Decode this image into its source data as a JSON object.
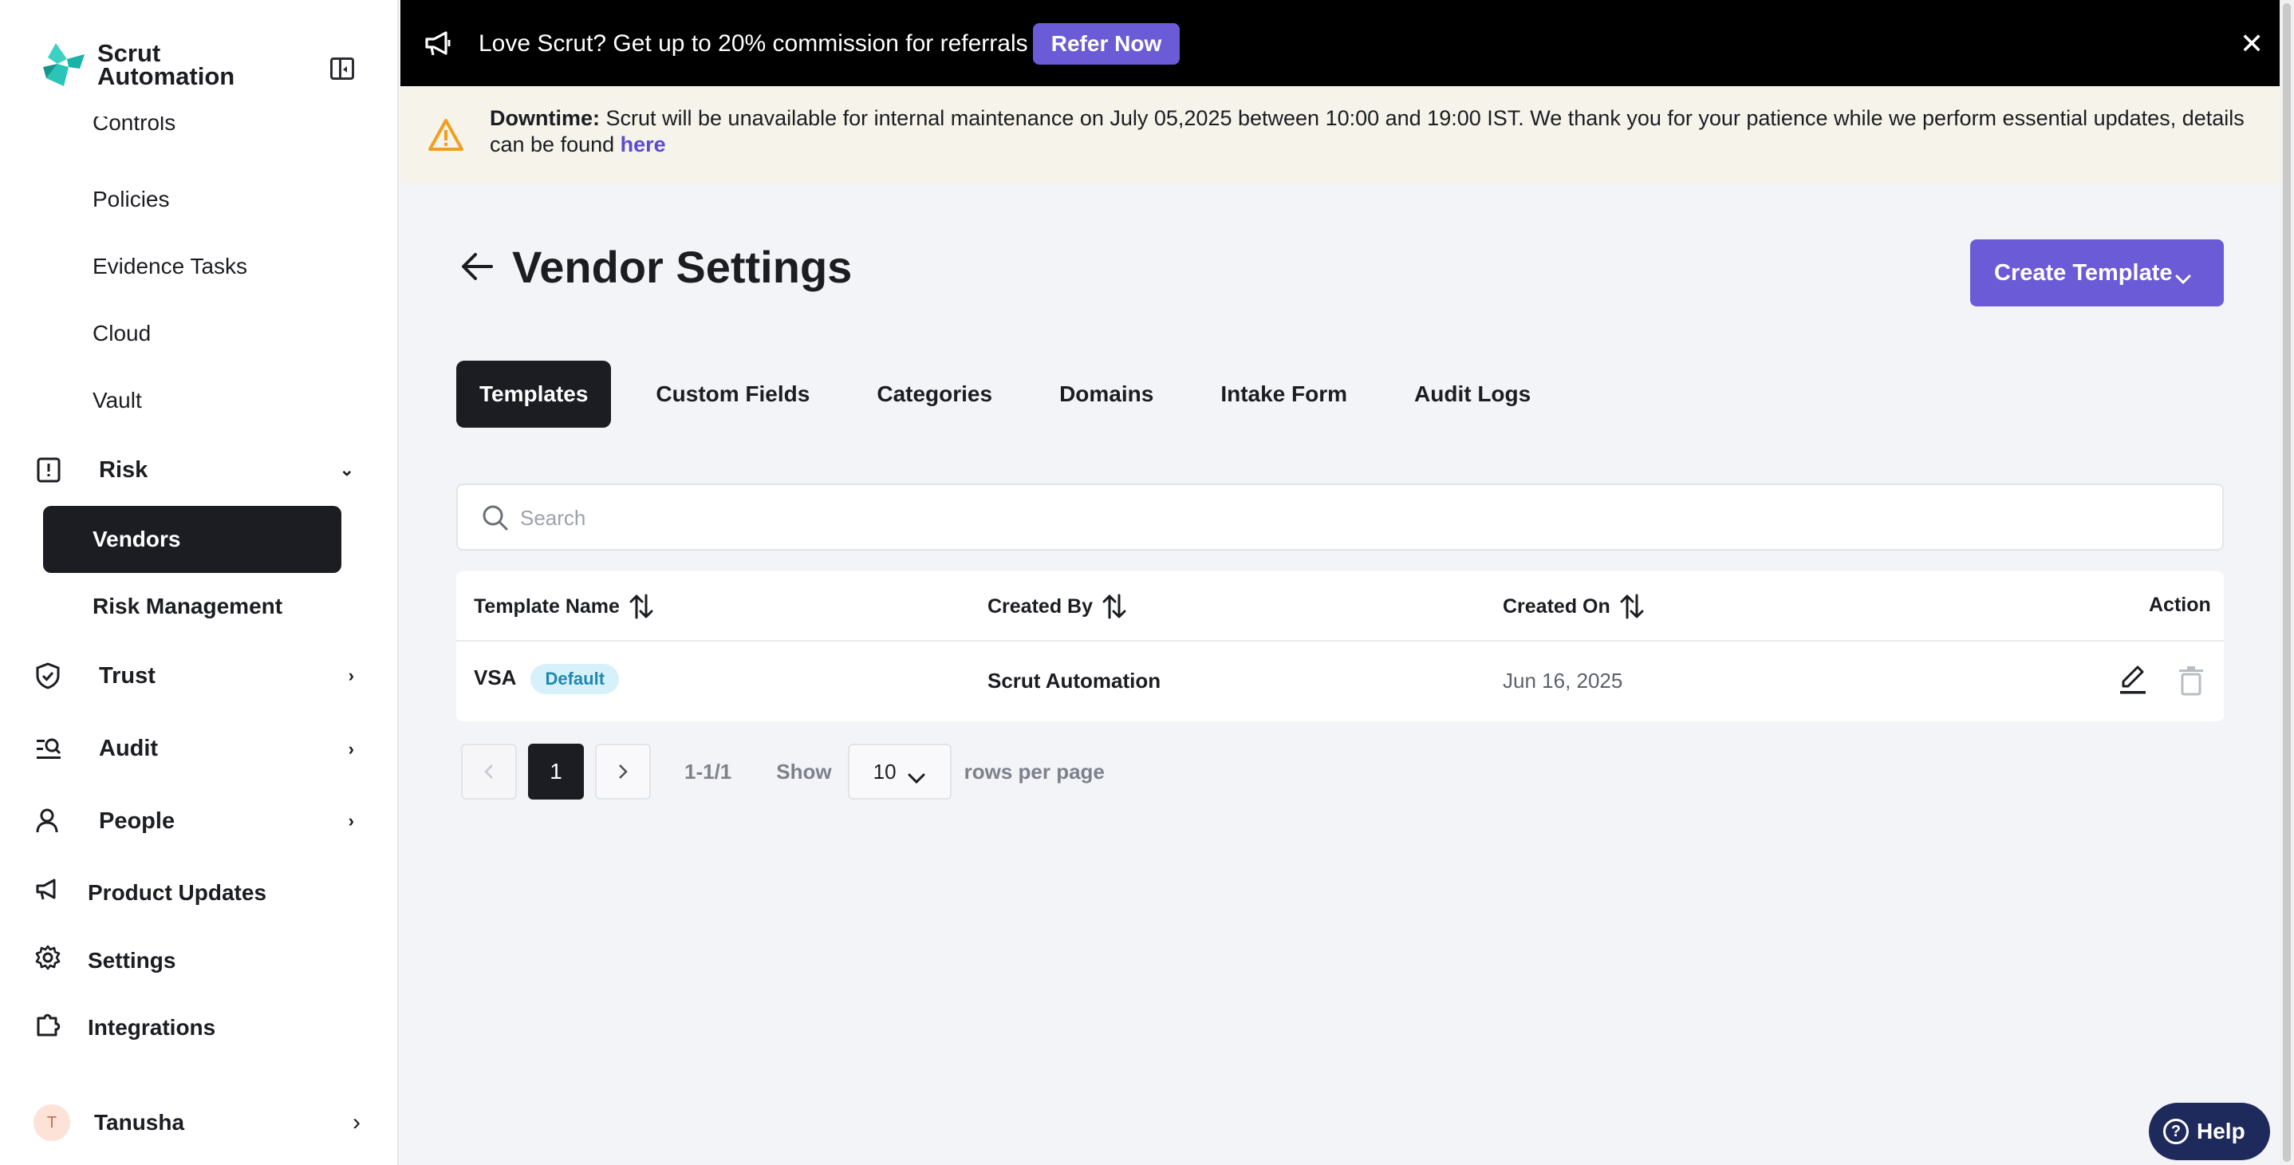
{
  "sidebar": {
    "logo": {
      "line1": "Scrut",
      "line2": "Automation"
    },
    "sub_items_top": [
      "Controls",
      "Policies",
      "Evidence Tasks",
      "Cloud",
      "Vault"
    ],
    "risk": {
      "label": "Risk",
      "icon": "risk-icon"
    },
    "risk_sub": {
      "active": "Vendors",
      "other": "Risk Management"
    },
    "trust": {
      "label": "Trust",
      "icon": "shield-check-icon"
    },
    "audit": {
      "label": "Audit",
      "icon": "audit-icon"
    },
    "people": {
      "label": "People",
      "icon": "person-icon"
    },
    "product_updates": {
      "label": "Product Updates",
      "icon": "megaphone-icon"
    },
    "settings": {
      "label": "Settings",
      "icon": "gear-icon"
    },
    "integrations": {
      "label": "Integrations",
      "icon": "puzzle-icon"
    },
    "user": {
      "initial": "T",
      "name": "Tanusha"
    }
  },
  "banner": {
    "text": "Love Scrut? Get up to 20% commission for referrals",
    "button": "Refer Now",
    "close": "✕"
  },
  "notice": {
    "label": "Downtime:",
    "text": " Scrut will be unavailable for internal maintenance on July 05,2025 between 10:00 and 19:00 IST. We thank you for your patience while we perform essential updates, details can be found ",
    "link": "here"
  },
  "page": {
    "title": "Vendor Settings",
    "create_button": "Create Template"
  },
  "tabs": [
    "Templates",
    "Custom Fields",
    "Categories",
    "Domains",
    "Intake Form",
    "Audit Logs"
  ],
  "search": {
    "placeholder": "Search"
  },
  "table": {
    "headers": {
      "name": "Template Name",
      "created_by": "Created By",
      "created_on": "Created On",
      "action": "Action"
    },
    "rows": [
      {
        "name": "VSA",
        "badge": "Default",
        "created_by": "Scrut Automation",
        "created_on": "Jun 16, 2025"
      }
    ]
  },
  "pagination": {
    "current_page": "1",
    "range": "1-1/1",
    "show_label": "Show",
    "page_size": "10",
    "rows_label": "rows per page"
  },
  "help": {
    "label": "Help"
  },
  "colors": {
    "accent": "#6b5bd6",
    "dark": "#1b1d22",
    "notice_bg": "#f6f3ea",
    "badge_bg": "#d7f1fb",
    "warning": "#f0a020"
  }
}
